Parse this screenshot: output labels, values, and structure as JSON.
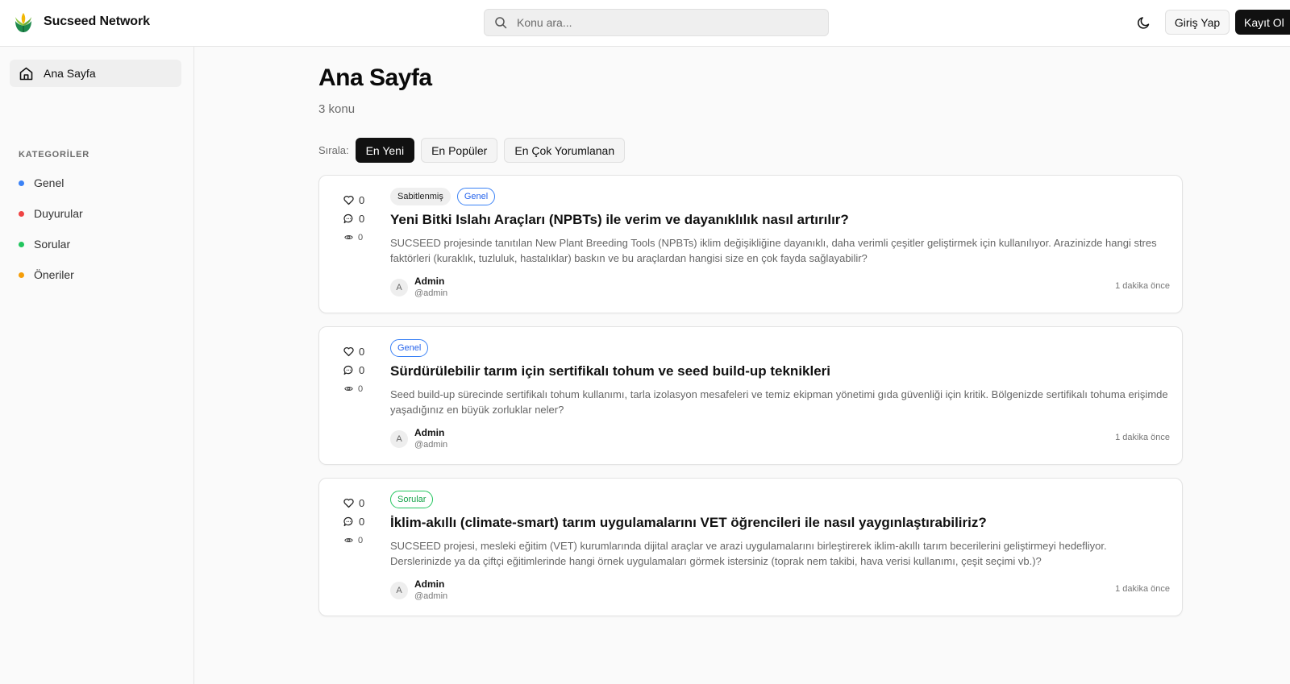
{
  "header": {
    "brand": "Sucseed Network",
    "search_placeholder": "Konu ara...",
    "login_label": "Giriş Yap",
    "register_label": "Kayıt Ol"
  },
  "sidebar": {
    "home_label": "Ana Sayfa",
    "categories_title": "KATEGORİLER",
    "categories": [
      {
        "label": "Genel",
        "color": "#3b82f6"
      },
      {
        "label": "Duyurular",
        "color": "#ef4444"
      },
      {
        "label": "Sorular",
        "color": "#22c55e"
      },
      {
        "label": "Öneriler",
        "color": "#f59e0b"
      }
    ]
  },
  "main": {
    "title": "Ana Sayfa",
    "count": "3 konu",
    "sort_label": "Sırala:",
    "sort_options": [
      "En Yeni",
      "En Popüler",
      "En Çok Yorumlanan"
    ],
    "posts": [
      {
        "likes": "0",
        "comments": "0",
        "views": "0",
        "pinned": "Sabitlenmiş",
        "category": "Genel",
        "title": "Yeni Bitki Islahı Araçları (NPBTs) ile verim ve dayanıklılık nasıl artırılır?",
        "excerpt": "SUCSEED projesinde tanıtılan New Plant Breeding Tools (NPBTs) iklim değişikliğine dayanıklı, daha verimli çeşitler geliştirmek için kullanılıyor. Arazinizde hangi stres faktörleri (kuraklık, tuzluluk, hastalıklar) baskın ve bu araçlardan hangisi size en çok fayda sağlayabilir?",
        "author_initial": "A",
        "author_name": "Admin",
        "author_handle": "@admin",
        "time": "1 dakika önce"
      },
      {
        "likes": "0",
        "comments": "0",
        "views": "0",
        "pinned": "",
        "category": "Genel",
        "title": "Sürdürülebilir tarım için sertifikalı tohum ve seed build-up teknikleri",
        "excerpt": "Seed build-up sürecinde sertifikalı tohum kullanımı, tarla izolasyon mesafeleri ve temiz ekipman yönetimi gıda güvenliği için kritik. Bölgenizde sertifikalı tohuma erişimde yaşadığınız en büyük zorluklar neler?",
        "author_initial": "A",
        "author_name": "Admin",
        "author_handle": "@admin",
        "time": "1 dakika önce"
      },
      {
        "likes": "0",
        "comments": "0",
        "views": "0",
        "pinned": "",
        "category": "Sorular",
        "title": "İklim-akıllı (climate-smart) tarım uygulamalarını VET öğrencileri ile nasıl yaygınlaştırabiliriz?",
        "excerpt": "SUCSEED projesi, mesleki eğitim (VET) kurumlarında dijital araçlar ve arazi uygulamalarını birleştirerek iklim-akıllı tarım becerilerini geliştirmeyi hedefliyor. Derslerinizde ya da çiftçi eğitimlerinde hangi örnek uygulamaları görmek istersiniz (toprak nem takibi, hava verisi kullanımı, çeşit seçimi vb.)?",
        "author_initial": "A",
        "author_name": "Admin",
        "author_handle": "@admin",
        "time": "1 dakika önce"
      }
    ]
  },
  "colors": {
    "badge_genel_text": "#2563eb",
    "badge_genel_border": "#3b82f6",
    "badge_sorular_text": "#16a34a",
    "badge_sorular_border": "#22c55e"
  }
}
